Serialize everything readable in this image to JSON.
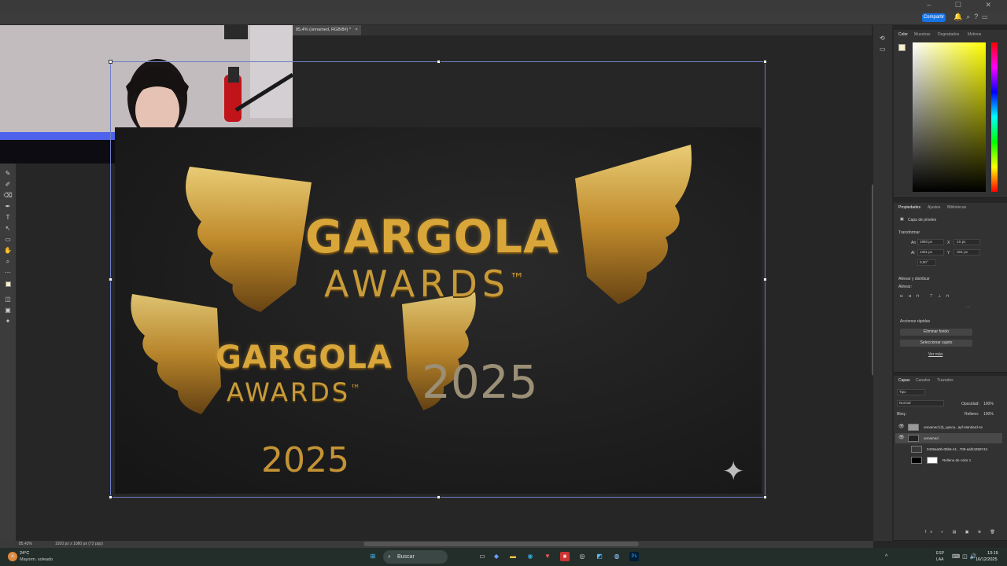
{
  "document": {
    "tab_label": "85,4% (unnamed, RGB/8#) *",
    "close_icon": "×"
  },
  "topbar": {
    "share_label": "Compartir",
    "window_controls": "–  ☐  ✕"
  },
  "canvas": {
    "logo_large": {
      "title": "GARGOLA",
      "subtitle": "AWARDS",
      "trademark": "™"
    },
    "logo_small": {
      "title": "GARGOLA",
      "subtitle": "AWARDS",
      "trademark": "™",
      "year": "2025"
    },
    "year_large": "2025",
    "accent_gold": "#d9a63a"
  },
  "statusbar": {
    "zoom": "85,43%",
    "doc_size": "1920 px x 1080 px (72 ppp)"
  },
  "color_panel": {
    "tabs": [
      "Color",
      "Muestras",
      "Degradados",
      "Motivos"
    ]
  },
  "properties_panel": {
    "tabs": [
      "Propiedades",
      "Ajustes",
      "Bibliotecas"
    ],
    "layer_kind": "Capa de píxeles",
    "transform_heading": "Transformar",
    "w_label": "An",
    "w_value": "1993 px",
    "h_label": "Al",
    "h_value": "1301 px",
    "x_label": "X",
    "x_value": "-15 px",
    "y_label": "Y",
    "y_value": "-201 px",
    "angle_value": "0,00°",
    "align_heading": "Alinear y distribuir",
    "align_sub": "Alinear:",
    "quick_heading": "Acciones rápidas",
    "quick_btn1": "Eliminar fondo",
    "quick_btn2": "Seleccionar sujeto",
    "more_link": "Ver más"
  },
  "layers_panel": {
    "tabs": [
      "Capas",
      "Canales",
      "Trazados"
    ],
    "filter_label": "Tipo",
    "blend_mode": "Normal",
    "opacity_label": "Opacidad:",
    "opacity_value": "100%",
    "lock_label": "Bloq.:",
    "fill_label": "Relleno:",
    "fill_value": "100%",
    "layers": [
      {
        "name": "unnamed (3)_upsca...ayf-standard-4x",
        "visible": true,
        "selected": false
      },
      {
        "name": "unnamed",
        "visible": true,
        "selected": true
      },
      {
        "name": "0436aa0b-05b6-41...709-aaf24359744",
        "visible": false,
        "selected": false
      },
      {
        "name": "Relleno de color 1",
        "visible": false,
        "selected": false
      }
    ]
  },
  "taskbar": {
    "weather_temp": "24°C",
    "weather_desc": "Mayorm. soleado",
    "search_label": "Buscar",
    "lang_top": "ESP",
    "lang_bottom": "LAA",
    "time": "13:15",
    "date": "16/12/2025"
  }
}
